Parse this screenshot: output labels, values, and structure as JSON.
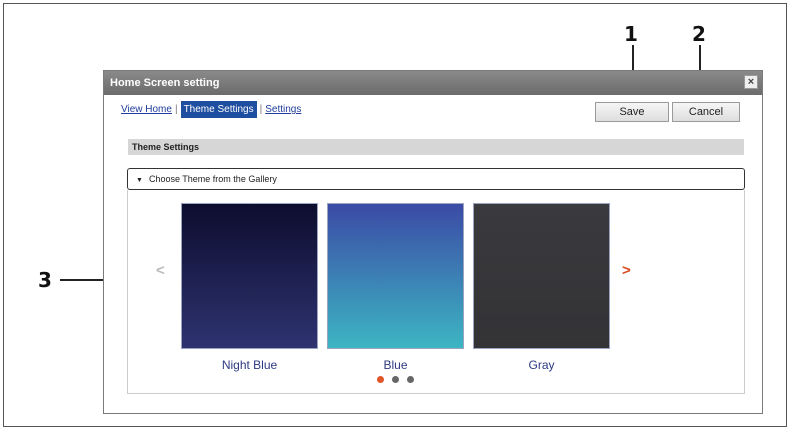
{
  "callouts": [
    "1",
    "2",
    "3"
  ],
  "dialog": {
    "title": "Home Screen setting",
    "close_icon": "close-icon"
  },
  "nav": {
    "view_home": "View Home",
    "theme_settings": "Theme Settings",
    "settings": "Settings",
    "separator": "|"
  },
  "buttons": {
    "save": "Save",
    "cancel": "Cancel"
  },
  "section": {
    "title": "Theme Settings"
  },
  "accordion": {
    "label": "Choose Theme from the Gallery",
    "icon": "triangle-down-icon"
  },
  "gallery": {
    "prev_arrow": "<",
    "next_arrow": ">",
    "prev_color": "#bbbbbb",
    "next_color": "#d9481f",
    "themes": [
      {
        "label": "Night Blue",
        "gradient_top": "#0d0d2e",
        "gradient_bottom": "#2e3370"
      },
      {
        "label": "Blue",
        "gradient_top": "#3b4aa5",
        "gradient_bottom": "#3db5c3"
      },
      {
        "label": "Gray",
        "gradient_top": "#3a3a3e",
        "gradient_bottom": "#333336"
      }
    ],
    "pager": {
      "pages": 3,
      "current": 1,
      "active_color": "#e0552a",
      "inactive_color": "#666666"
    }
  }
}
